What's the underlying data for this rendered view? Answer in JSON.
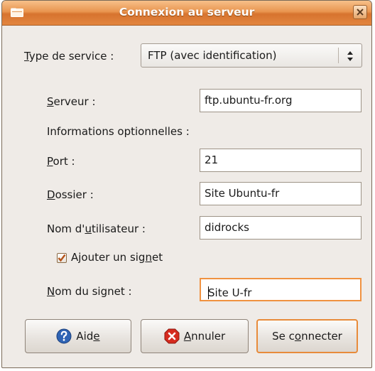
{
  "window": {
    "title": "Connexion au serveur",
    "close_glyph": "×"
  },
  "service_type": {
    "label_first": "T",
    "label_rest": "ype de service :",
    "value": "FTP (avec identification)"
  },
  "server": {
    "label_first": "S",
    "label_rest": "erveur :",
    "value": "ftp.ubuntu-fr.org"
  },
  "optional_header": "Informations optionnelles :",
  "port": {
    "label_first": "P",
    "label_rest": "ort :",
    "value": "21"
  },
  "folder": {
    "label_first": "D",
    "label_rest": "ossier :",
    "value": "Site Ubuntu-fr"
  },
  "username": {
    "label_pre": "Nom d'",
    "label_u": "u",
    "label_rest": "tilisateur :",
    "value": "didrocks"
  },
  "bookmark_checkbox": {
    "checked": true,
    "label_pre": "Ajouter un sig",
    "label_u": "n",
    "label_rest": "et"
  },
  "bookmark_name": {
    "label_first": "N",
    "label_rest": "om du signet :",
    "value": "Site U-fr"
  },
  "buttons": {
    "help": {
      "pre": "Aid",
      "u": "e",
      "rest": ""
    },
    "cancel": {
      "pre": "",
      "u": "A",
      "rest": "nnuler"
    },
    "connect": {
      "pre": "Se c",
      "u": "o",
      "rest": "nnecter"
    }
  },
  "colors": {
    "accent": "#e88b3a",
    "titlebar": "#e9954f",
    "help_icon": "#2f64b4",
    "cancel_icon": "#d52a1e"
  }
}
